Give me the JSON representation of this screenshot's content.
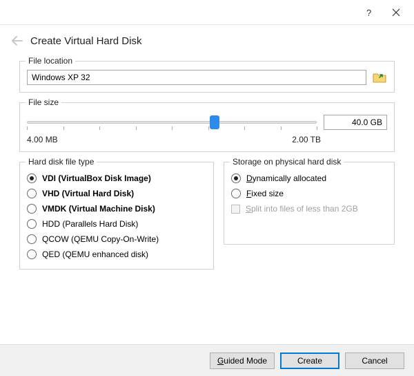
{
  "header": {
    "title": "Create Virtual Hard Disk"
  },
  "file_location": {
    "legend": "File location",
    "value": "Windows XP 32"
  },
  "file_size": {
    "legend": "File size",
    "value": "40.0 GB",
    "min_label": "4.00 MB",
    "max_label": "2.00 TB",
    "slider_percent": 63
  },
  "type_group": {
    "legend": "Hard disk file type",
    "options": [
      {
        "label": "VDI (VirtualBox Disk Image)",
        "bold": true,
        "selected": true
      },
      {
        "label": "VHD (Virtual Hard Disk)",
        "bold": true,
        "selected": false
      },
      {
        "label": "VMDK (Virtual Machine Disk)",
        "bold": true,
        "selected": false
      },
      {
        "label": "HDD (Parallels Hard Disk)",
        "bold": false,
        "selected": false
      },
      {
        "label": "QCOW (QEMU Copy-On-Write)",
        "bold": false,
        "selected": false
      },
      {
        "label": "QED (QEMU enhanced disk)",
        "bold": false,
        "selected": false
      }
    ]
  },
  "storage_group": {
    "legend": "Storage on physical hard disk",
    "options": [
      {
        "label": "Dynamically allocated",
        "selected": true
      },
      {
        "label": "Fixed size",
        "selected": false
      }
    ],
    "split_label": "Split into files of less than 2GB"
  },
  "footer": {
    "guided": "Guided Mode",
    "create": "Create",
    "cancel": "Cancel"
  }
}
